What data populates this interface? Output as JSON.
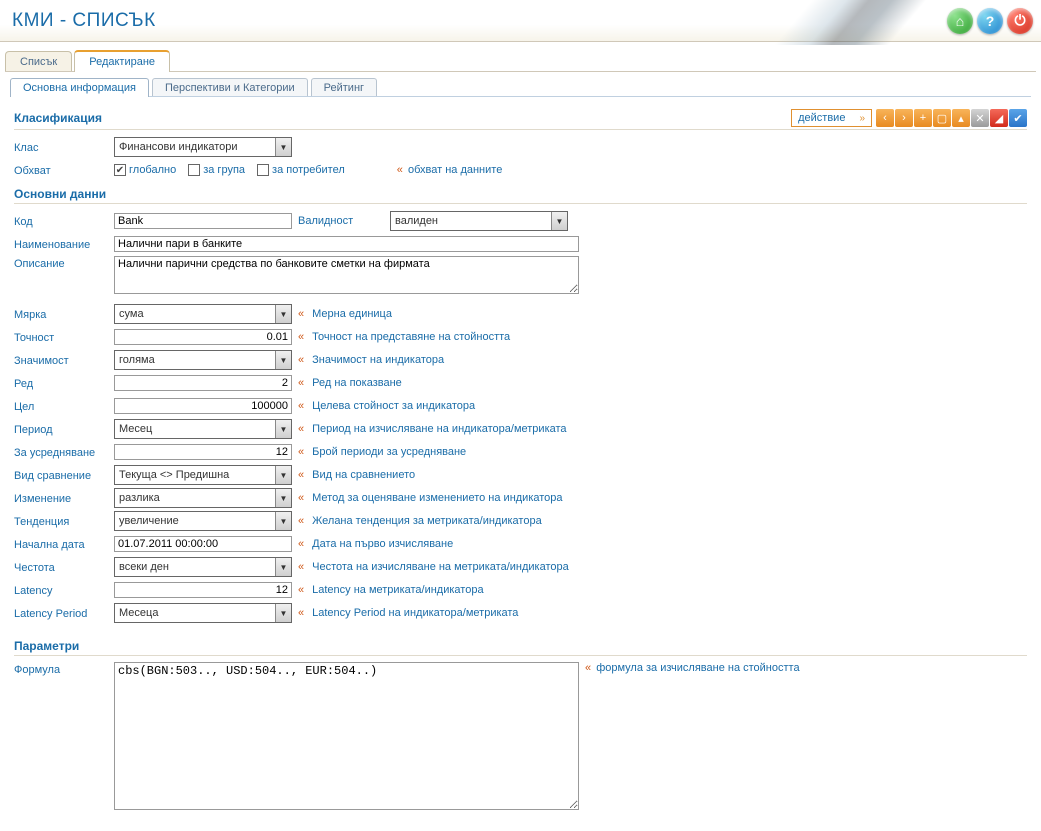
{
  "header": {
    "title": "КМИ - СПИСЪК"
  },
  "tabs": {
    "list": "Списък",
    "edit": "Редактиране"
  },
  "subtabs": {
    "basic": "Основна информация",
    "perspectives": "Перспективи и Категории",
    "rating": "Рейтинг"
  },
  "sections": {
    "classification": "Класификация",
    "basicdata": "Основни данни",
    "parameters": "Параметри"
  },
  "action": {
    "label": "действие",
    "arrow": "»"
  },
  "labels": {
    "class": "Клас",
    "scope": "Обхват",
    "code": "Код",
    "validity": "Валидност",
    "name": "Наименование",
    "description": "Описание",
    "measure": "Мярка",
    "precision": "Точност",
    "importance": "Значимост",
    "order": "Ред",
    "target": "Цел",
    "period": "Период",
    "averaging": "За усредняване",
    "comptype": "Вид сравнение",
    "change": "Изменение",
    "trend": "Тенденция",
    "startdate": "Начална дата",
    "frequency": "Честота",
    "latency": "Latency",
    "latencyperiod": "Latency Period",
    "formula": "Формула"
  },
  "values": {
    "class": "Финансови индикатори",
    "scope_global": "глобално",
    "scope_group": "за група",
    "scope_user": "за потребител",
    "code": "Bank",
    "validity": "валиден",
    "name": "Налични пари в банките",
    "description": "Налични парични средства по банковите сметки на фирмата",
    "measure": "сума",
    "precision": "0.01",
    "importance": "голяма",
    "order": "2",
    "target": "100000",
    "period": "Месец",
    "averaging": "12",
    "comptype": "Текуща <> Предишна",
    "change": "разлика",
    "trend": "увеличение",
    "startdate": "01.07.2011 00:00:00",
    "frequency": "всеки ден",
    "latency": "12",
    "latencyperiod": "Месеца",
    "formula": "cbs(BGN:503.., USD:504.., EUR:504..)"
  },
  "hints": {
    "scope": "обхват на данните",
    "measure": "Мерна единица",
    "precision": "Точност на представяне на стойността",
    "importance": "Значимост на индикатора",
    "order": "Ред на показване",
    "target": "Целева стойност за индикатора",
    "period": "Период на изчисляване на индикатора/метриката",
    "averaging": "Брой периоди за усредняване",
    "comptype": "Вид на сравнението",
    "change": "Метод за оценяване изменението на индикатора",
    "trend": "Желана тенденция за метриката/индикатора",
    "startdate": "Дата на първо изчисляване",
    "frequency": "Честота на изчисляване на метриката/индикатора",
    "latency": "Latency на метриката/индикатора",
    "latencyperiod": "Latency Period на индикатора/метриката",
    "formula": "формула за изчисляване на стойността"
  },
  "checkmarks": {
    "check": "✔"
  }
}
